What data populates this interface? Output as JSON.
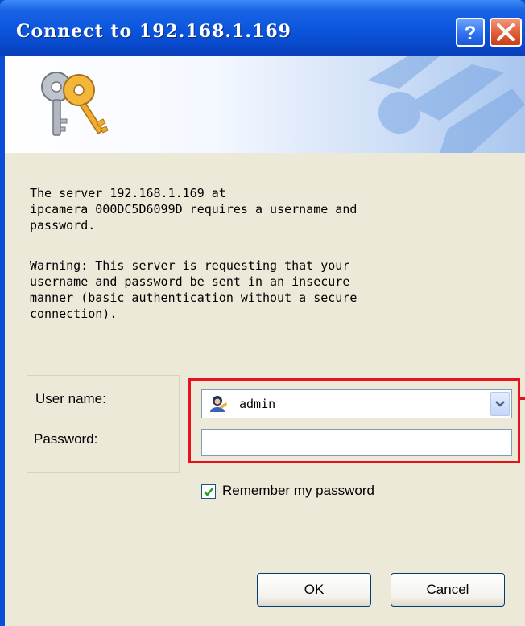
{
  "window": {
    "title": "Connect to 192.168.1.169",
    "help_glyph": "?",
    "close_glyph": "X"
  },
  "colors": {
    "titlebar": "#0a55dc",
    "highlight": "#e8121e",
    "dialog_bg": "#ece9d8"
  },
  "icons": {
    "banner": "keys-icon",
    "user": "user-icon",
    "dropdown": "chevron-down-icon",
    "check": "checkmark-icon"
  },
  "message": {
    "line1": "The server 192.168.1.169 at",
    "line2": "ipcamera_000DC5D6099D requires a username and",
    "line3": "password.",
    "warning1": "Warning: This server is requesting that your",
    "warning2": "username and password be sent in an insecure",
    "warning3": "manner (basic authentication without a secure",
    "warning4": "connection)."
  },
  "form": {
    "username_label": "User name:",
    "username_value": "admin",
    "password_label": "Password:",
    "password_value": "",
    "remember_label": "Remember my password",
    "remember_checked": true
  },
  "buttons": {
    "ok": "OK",
    "cancel": "Cancel"
  }
}
